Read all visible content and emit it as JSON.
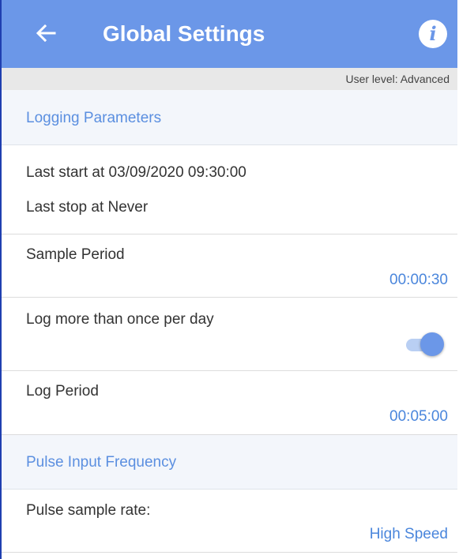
{
  "header": {
    "title": "Global Settings",
    "back_icon": "arrow-left-icon",
    "info_icon": "info-icon",
    "info_glyph": "i",
    "background_color": "#6b97e8"
  },
  "user_level": "User level: Advanced",
  "sections": {
    "logging": {
      "header": "Logging Parameters",
      "last_start": "Last start at 03/09/2020 09:30:00",
      "last_stop": "Last stop at Never",
      "sample_period": {
        "label": "Sample Period",
        "value": "00:00:30"
      },
      "log_more": {
        "label": "Log more than once per day",
        "enabled": true
      },
      "log_period": {
        "label": "Log Period",
        "value": "00:05:00"
      }
    },
    "pulse": {
      "header": "Pulse Input Frequency",
      "sample_rate": {
        "label": "Pulse sample rate:",
        "value": "High Speed"
      }
    }
  },
  "colors": {
    "accent": "#6b97e8",
    "value_text": "#4a86dc",
    "section_header_bg": "#f3f6fb"
  }
}
